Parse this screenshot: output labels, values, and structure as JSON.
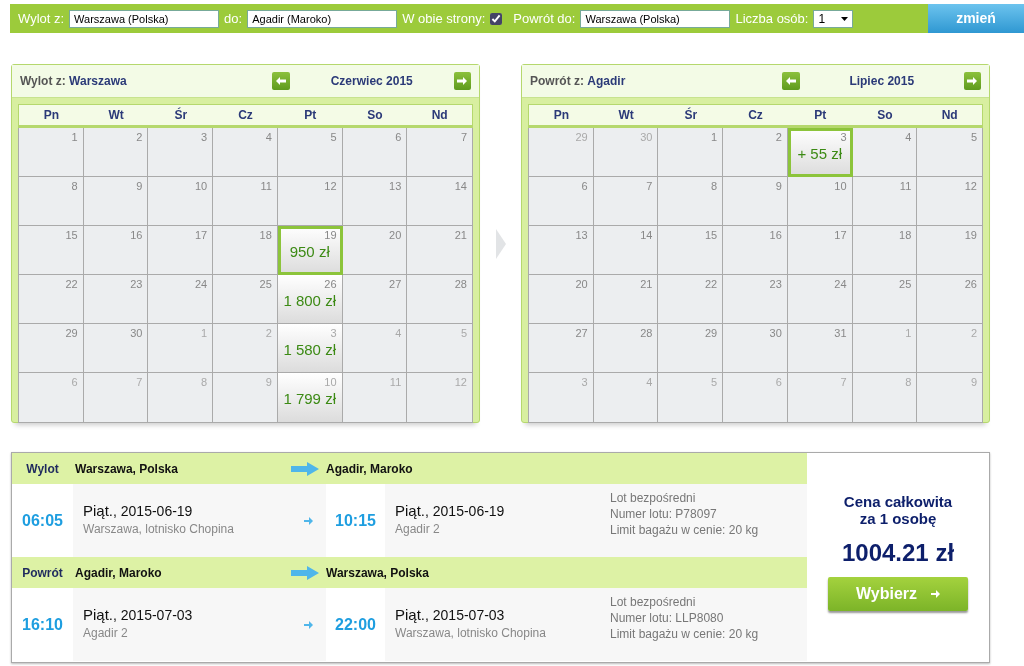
{
  "search_bar": {
    "from_label": "Wylot z:",
    "from_value": "Warszawa (Polska)",
    "to_label": "do:",
    "to_value": "Agadir (Maroko)",
    "round_trip_label": "W obie strony:",
    "round_trip_checked": true,
    "return_label": "Powrót do:",
    "return_value": "Warszawa (Polska)",
    "passengers_label": "Liczba osób:",
    "passengers_value": "1",
    "submit": "zmień"
  },
  "calendars": [
    {
      "label": "Wylot z:",
      "city": "Warszawa",
      "month": "Czerwiec 2015",
      "weekdays": [
        "Pn",
        "Wt",
        "Śr",
        "Cz",
        "Pt",
        "So",
        "Nd"
      ],
      "days": [
        {
          "day": "1",
          "muted": false,
          "selected": false
        },
        {
          "day": "2",
          "muted": false,
          "selected": false
        },
        {
          "day": "3",
          "muted": false,
          "selected": false
        },
        {
          "day": "4",
          "muted": false,
          "selected": false
        },
        {
          "day": "5",
          "muted": false,
          "selected": false
        },
        {
          "day": "6",
          "muted": false,
          "selected": false
        },
        {
          "day": "7",
          "muted": false,
          "selected": false
        },
        {
          "day": "8",
          "muted": false,
          "selected": false
        },
        {
          "day": "9",
          "muted": false,
          "selected": false
        },
        {
          "day": "10",
          "muted": false,
          "selected": false
        },
        {
          "day": "11",
          "muted": false,
          "selected": false
        },
        {
          "day": "12",
          "muted": false,
          "selected": false
        },
        {
          "day": "13",
          "muted": false,
          "selected": false
        },
        {
          "day": "14",
          "muted": false,
          "selected": false
        },
        {
          "day": "15",
          "muted": false,
          "selected": false
        },
        {
          "day": "16",
          "muted": false,
          "selected": false
        },
        {
          "day": "17",
          "muted": false,
          "selected": false
        },
        {
          "day": "18",
          "muted": false,
          "selected": false
        },
        {
          "day": "19",
          "muted": false,
          "selected": true,
          "price": "950 zł"
        },
        {
          "day": "20",
          "muted": false,
          "selected": false
        },
        {
          "day": "21",
          "muted": false,
          "selected": false
        },
        {
          "day": "22",
          "muted": false,
          "selected": false
        },
        {
          "day": "23",
          "muted": false,
          "selected": false
        },
        {
          "day": "24",
          "muted": false,
          "selected": false
        },
        {
          "day": "25",
          "muted": false,
          "selected": false
        },
        {
          "day": "26",
          "muted": false,
          "selected": false,
          "price": "1 800 zł"
        },
        {
          "day": "27",
          "muted": false,
          "selected": false
        },
        {
          "day": "28",
          "muted": false,
          "selected": false
        },
        {
          "day": "29",
          "muted": false,
          "selected": false
        },
        {
          "day": "30",
          "muted": false,
          "selected": false
        },
        {
          "day": "1",
          "muted": true,
          "selected": false
        },
        {
          "day": "2",
          "muted": true,
          "selected": false
        },
        {
          "day": "3",
          "muted": true,
          "selected": false,
          "price": "1 580 zł"
        },
        {
          "day": "4",
          "muted": true,
          "selected": false
        },
        {
          "day": "5",
          "muted": true,
          "selected": false
        },
        {
          "day": "6",
          "muted": true,
          "selected": false
        },
        {
          "day": "7",
          "muted": true,
          "selected": false
        },
        {
          "day": "8",
          "muted": true,
          "selected": false
        },
        {
          "day": "9",
          "muted": true,
          "selected": false
        },
        {
          "day": "10",
          "muted": true,
          "selected": false,
          "price": "1 799 zł"
        },
        {
          "day": "11",
          "muted": true,
          "selected": false
        },
        {
          "day": "12",
          "muted": true,
          "selected": false
        }
      ]
    },
    {
      "label": "Powrót z:",
      "city": "Agadir",
      "month": "Lipiec 2015",
      "weekdays": [
        "Pn",
        "Wt",
        "Śr",
        "Cz",
        "Pt",
        "So",
        "Nd"
      ],
      "days": [
        {
          "day": "29",
          "muted": true,
          "selected": false
        },
        {
          "day": "30",
          "muted": true,
          "selected": false
        },
        {
          "day": "1",
          "muted": false,
          "selected": false
        },
        {
          "day": "2",
          "muted": false,
          "selected": false
        },
        {
          "day": "3",
          "muted": false,
          "selected": true,
          "price": "+ 55 zł"
        },
        {
          "day": "4",
          "muted": false,
          "selected": false
        },
        {
          "day": "5",
          "muted": false,
          "selected": false
        },
        {
          "day": "6",
          "muted": false,
          "selected": false
        },
        {
          "day": "7",
          "muted": false,
          "selected": false
        },
        {
          "day": "8",
          "muted": false,
          "selected": false
        },
        {
          "day": "9",
          "muted": false,
          "selected": false
        },
        {
          "day": "10",
          "muted": false,
          "selected": false
        },
        {
          "day": "11",
          "muted": false,
          "selected": false
        },
        {
          "day": "12",
          "muted": false,
          "selected": false
        },
        {
          "day": "13",
          "muted": false,
          "selected": false
        },
        {
          "day": "14",
          "muted": false,
          "selected": false
        },
        {
          "day": "15",
          "muted": false,
          "selected": false
        },
        {
          "day": "16",
          "muted": false,
          "selected": false
        },
        {
          "day": "17",
          "muted": false,
          "selected": false
        },
        {
          "day": "18",
          "muted": false,
          "selected": false
        },
        {
          "day": "19",
          "muted": false,
          "selected": false
        },
        {
          "day": "20",
          "muted": false,
          "selected": false
        },
        {
          "day": "21",
          "muted": false,
          "selected": false
        },
        {
          "day": "22",
          "muted": false,
          "selected": false
        },
        {
          "day": "23",
          "muted": false,
          "selected": false
        },
        {
          "day": "24",
          "muted": false,
          "selected": false
        },
        {
          "day": "25",
          "muted": false,
          "selected": false
        },
        {
          "day": "26",
          "muted": false,
          "selected": false
        },
        {
          "day": "27",
          "muted": false,
          "selected": false
        },
        {
          "day": "28",
          "muted": false,
          "selected": false
        },
        {
          "day": "29",
          "muted": false,
          "selected": false
        },
        {
          "day": "30",
          "muted": false,
          "selected": false
        },
        {
          "day": "31",
          "muted": false,
          "selected": false
        },
        {
          "day": "1",
          "muted": true,
          "selected": false
        },
        {
          "day": "2",
          "muted": true,
          "selected": false
        },
        {
          "day": "3",
          "muted": true,
          "selected": false
        },
        {
          "day": "4",
          "muted": true,
          "selected": false
        },
        {
          "day": "5",
          "muted": true,
          "selected": false
        },
        {
          "day": "6",
          "muted": true,
          "selected": false
        },
        {
          "day": "7",
          "muted": true,
          "selected": false
        },
        {
          "day": "8",
          "muted": true,
          "selected": false
        },
        {
          "day": "9",
          "muted": true,
          "selected": false
        }
      ]
    }
  ],
  "legs": [
    {
      "label": "Wylot",
      "from": "Warszawa, Polska",
      "to": "Agadir, Maroko",
      "dep_time": "06:05",
      "dep_day": "Piąt.",
      "dep_date": ", 2015-06-19",
      "dep_airport": "Warszawa, lotnisko Chopina",
      "arr_time": "10:15",
      "arr_day": "Piąt.",
      "arr_date": ", 2015-06-19",
      "arr_airport": "Agadir 2",
      "info": [
        "Lot bezpośredni",
        "Numer lotu: P78097",
        "Limit bagażu w cenie: 20 kg"
      ]
    },
    {
      "label": "Powrót",
      "from": "Agadir, Maroko",
      "to": "Warszawa, Polska",
      "dep_time": "16:10",
      "dep_day": "Piąt.",
      "dep_date": ", 2015-07-03",
      "dep_airport": "Agadir 2",
      "arr_time": "22:00",
      "arr_day": "Piąt.",
      "arr_date": ", 2015-07-03",
      "arr_airport": "Warszawa, lotnisko Chopina",
      "info": [
        "Lot bezpośredni",
        "Numer lotu: LLP8080",
        "Limit bagażu w cenie: 20 kg"
      ]
    }
  ],
  "price": {
    "label_line1": "Cena całkowita",
    "label_line2": "za 1 osobę",
    "amount": "1004.21 zł",
    "button": "Wybierz"
  }
}
